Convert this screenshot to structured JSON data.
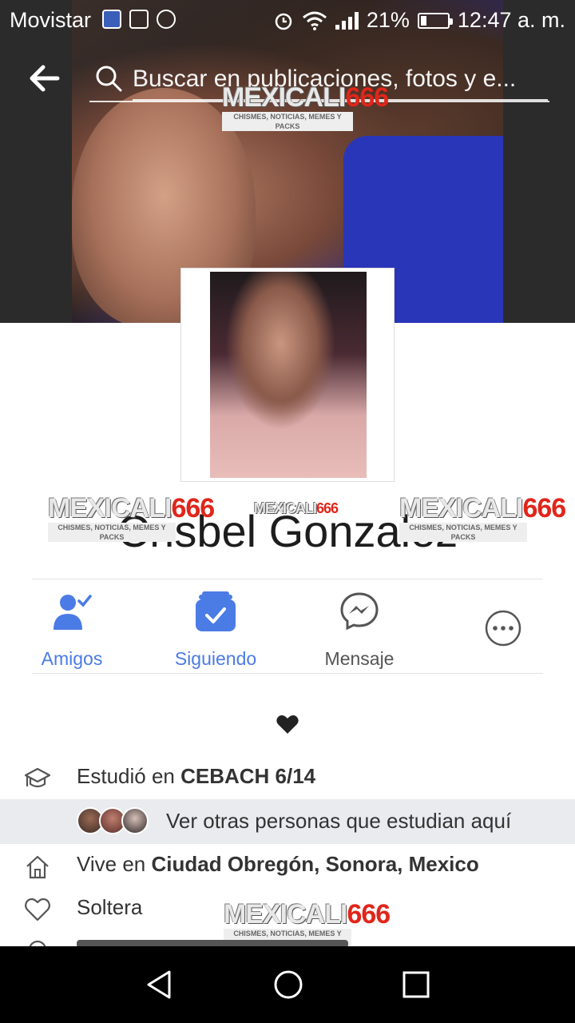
{
  "status_bar": {
    "carrier": "Movistar",
    "battery": "21%",
    "battery_level": 0.21,
    "time": "12:47 a. m."
  },
  "search": {
    "placeholder": "Buscar en publicaciones, fotos y e..."
  },
  "watermark": {
    "brand_a": "MEXICALI",
    "brand_b": "666",
    "tagline": "CHISMES, NOTICIAS, MEMES Y PACKS"
  },
  "profile": {
    "name": "Crisbel Gonzalez"
  },
  "actions": [
    {
      "label": "Amigos"
    },
    {
      "label": "Siguiendo"
    },
    {
      "label": "Mensaje"
    }
  ],
  "about": {
    "studied_prefix": "Estudió en ",
    "studied_place": "CEBACH 6/14",
    "see_others": "Ver otras personas que estudian aquí",
    "lives_prefix": "Vive en ",
    "lives_place": "Ciudad Obregón, Sonora, Mexico",
    "relationship": "Soltera"
  },
  "colors": {
    "accent": "#4b7be5",
    "text": "#333333",
    "divider": "#e1e2e6"
  }
}
